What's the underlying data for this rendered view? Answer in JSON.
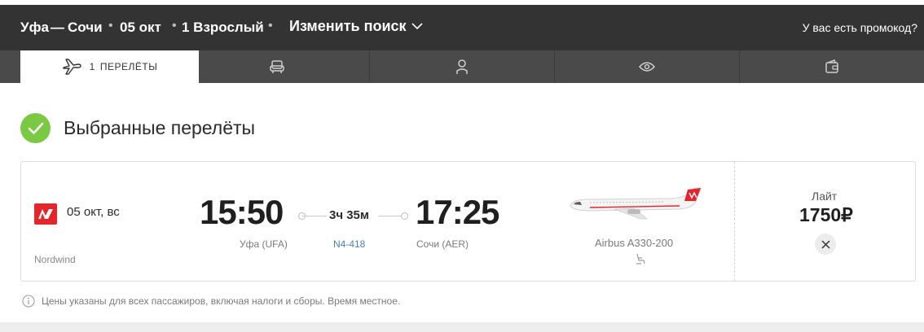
{
  "header": {
    "from": "Уфа",
    "dash": "—",
    "to": "Сочи",
    "date": "05 окт",
    "passengers": "1 Взрослый",
    "change_search": "Изменить поиск",
    "promo": "У вас есть промокод?"
  },
  "tabs": {
    "active_count": "1",
    "active_label": "ПЕРЕЛЁТЫ",
    "icons": [
      "plane-icon",
      "seat-icon",
      "passenger-icon",
      "eye-icon",
      "wallet-icon"
    ]
  },
  "section": {
    "title": "Выбранные перелёты"
  },
  "flight": {
    "date": "05 окт, вс",
    "airline": "Nordwind",
    "departure_time": "15:50",
    "departure_airport": "Уфа (UFA)",
    "arrival_time": "17:25",
    "arrival_airport": "Сочи (AER)",
    "duration": "3ч 35м",
    "flight_number": "N4-418",
    "aircraft": "Airbus A330-200",
    "tariff": "Лайт",
    "price": "1750₽"
  },
  "note": {
    "text": "Цены указаны для всех пассажиров, включая налоги и сборы. Время местное."
  },
  "colors": {
    "header_bg": "#333333",
    "tabs_bg": "#4a4a4a",
    "check_green": "#7ac943",
    "airline_red": "#e2262c",
    "link_blue": "#4a7fbf"
  }
}
